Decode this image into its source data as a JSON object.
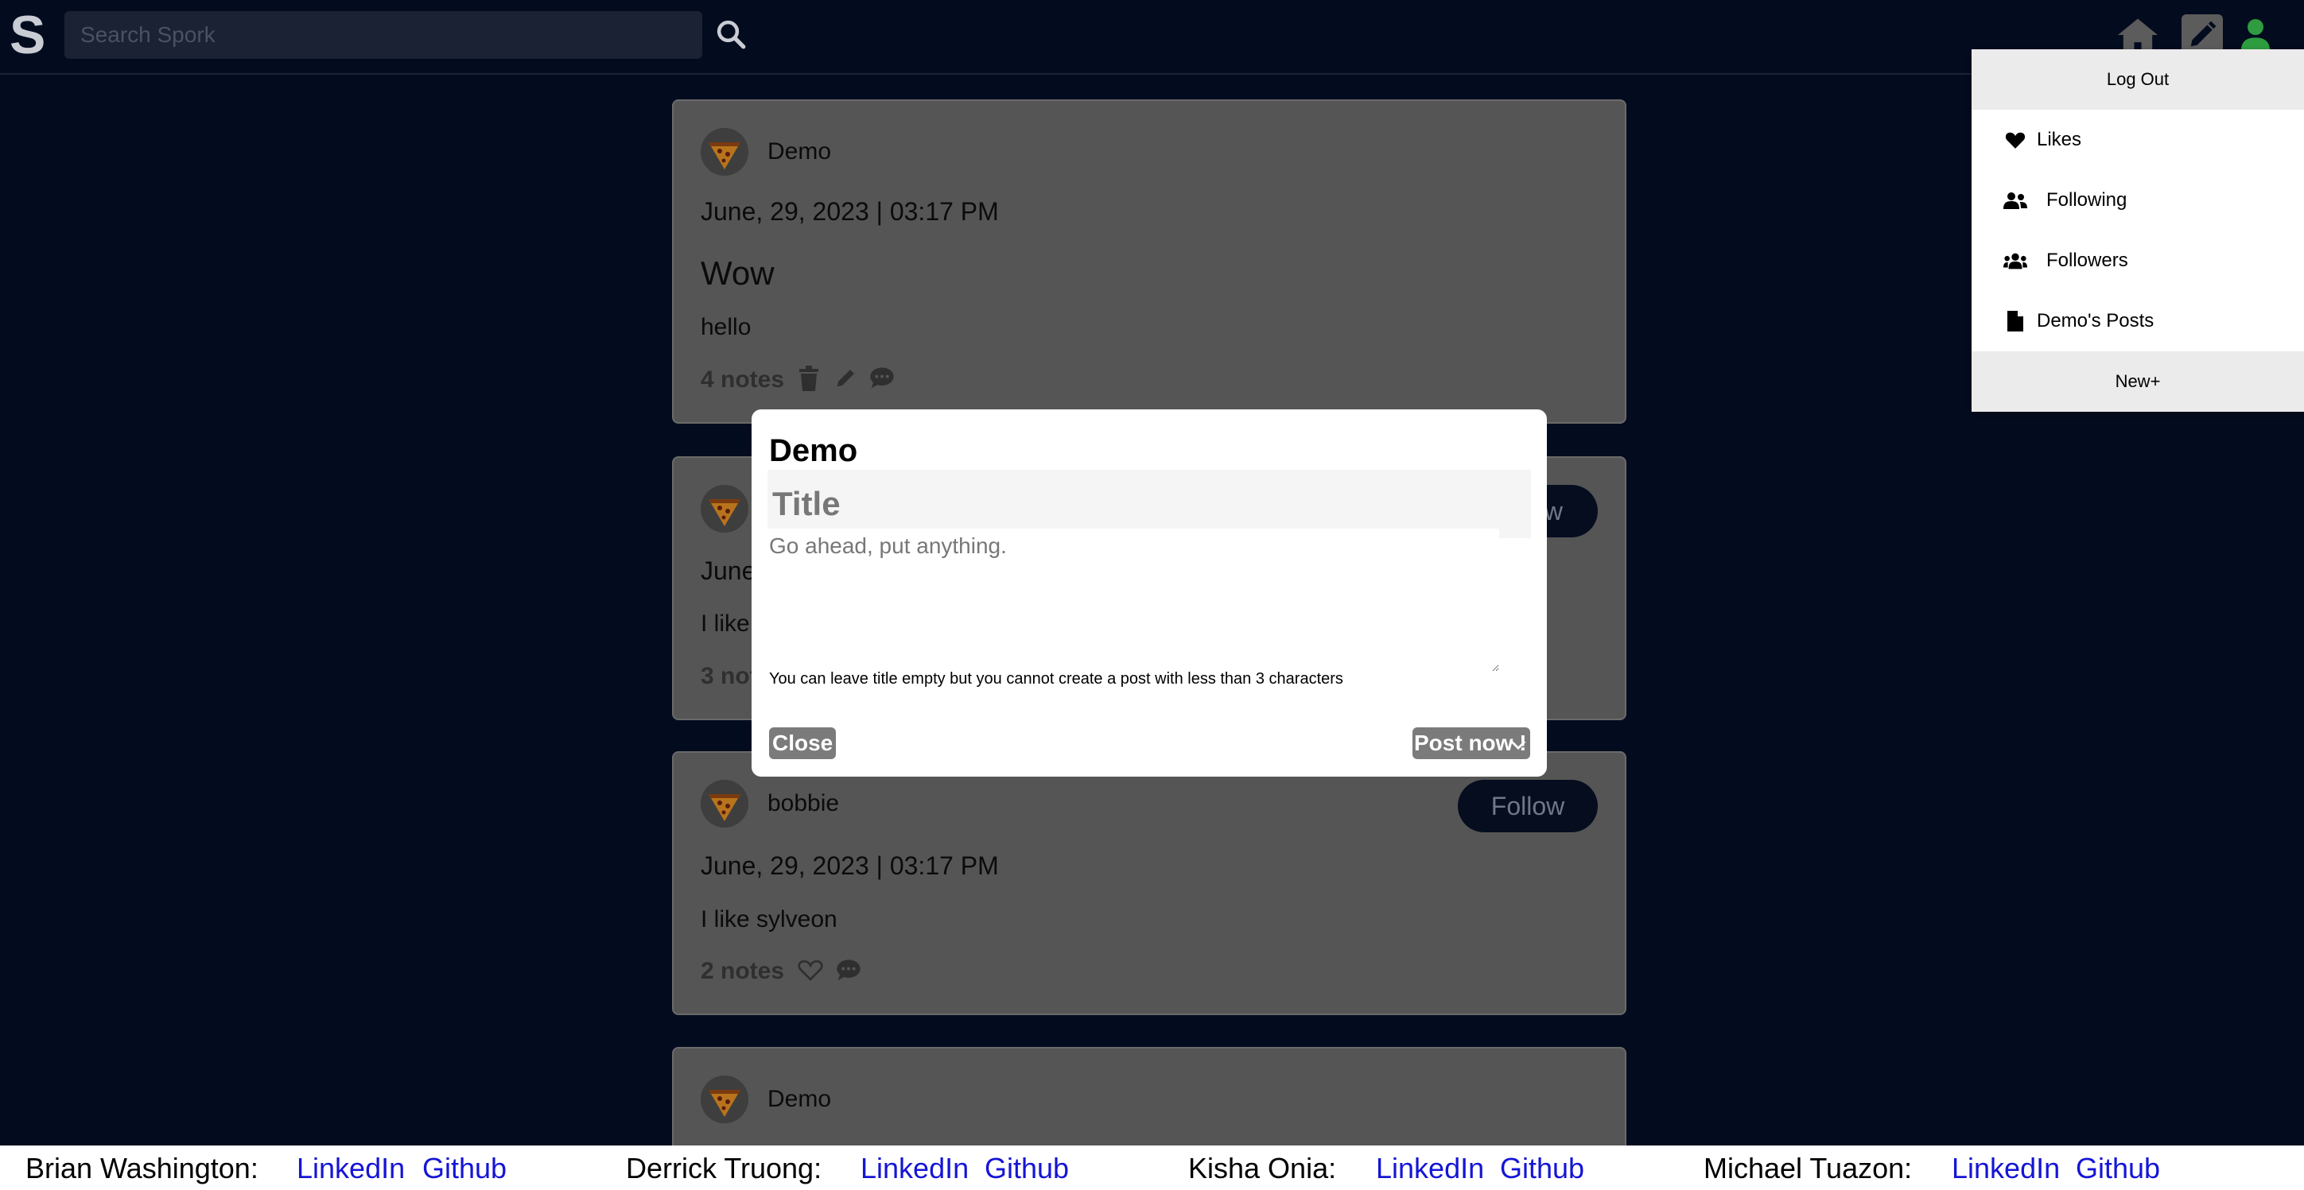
{
  "header": {
    "logo": "S",
    "search_placeholder": "Search Spork"
  },
  "posts": [
    {
      "author": "Demo",
      "date": "June, 29, 2023 | 03:17 PM",
      "title": "Wow",
      "body": "hello",
      "notes": "4 notes"
    },
    {
      "author": "",
      "date": "June",
      "body": "I like",
      "notes": "3 not",
      "follow_label": "w"
    },
    {
      "author": "bobbie",
      "date": "June, 29, 2023 | 03:17 PM",
      "body": "I like sylveon",
      "notes": "2 notes",
      "follow_label": "Follow"
    },
    {
      "author": "Demo"
    }
  ],
  "dropdown": {
    "logout": "Log Out",
    "items": [
      {
        "label": "Likes",
        "icon": "heart-icon"
      },
      {
        "label": "Following",
        "icon": "user-group-icon"
      },
      {
        "label": "Followers",
        "icon": "users-icon"
      },
      {
        "label": "Demo's Posts",
        "icon": "file-icon"
      }
    ],
    "new": "New+"
  },
  "modal": {
    "user": "Demo",
    "title_placeholder": "Title",
    "body_placeholder": "Go ahead, put anything.",
    "hint": "You can leave title empty but you cannot create a post with less than 3 characters",
    "close_label": "Close",
    "post_label": "Post now !"
  },
  "footer": {
    "people": [
      {
        "name": "Brian Washington:",
        "linkedin": "LinkedIn",
        "github": "Github"
      },
      {
        "name": "Derrick Truong:",
        "linkedin": "LinkedIn",
        "github": "Github"
      },
      {
        "name": "Kisha Onia:",
        "linkedin": "LinkedIn",
        "github": "Github"
      },
      {
        "name": "Michael Tuazon:",
        "linkedin": "LinkedIn",
        "github": "Github"
      }
    ]
  },
  "colors": {
    "background": "#030c1f",
    "post_bg": "#555555",
    "link": "#1515d6",
    "user_icon": "#2e9c3f"
  }
}
